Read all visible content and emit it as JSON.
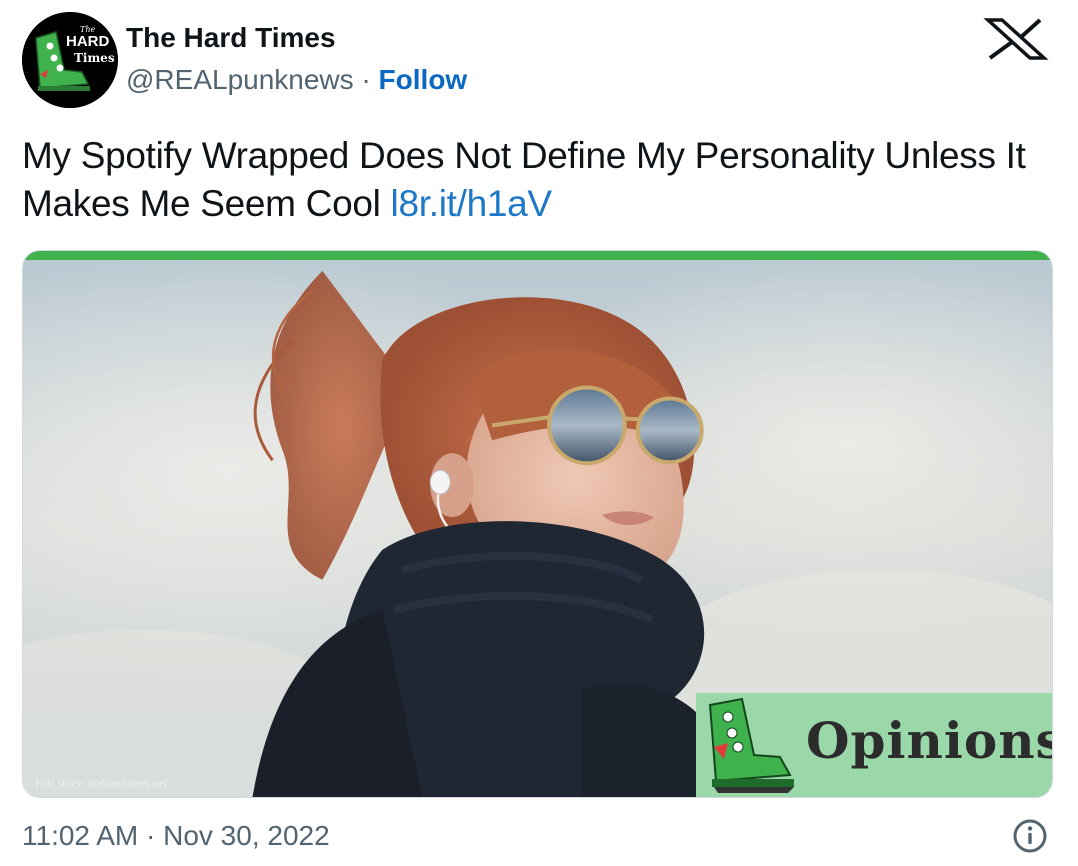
{
  "author": {
    "display_name": "The Hard Times",
    "handle": "@REALpunknews",
    "separator": "·",
    "follow_label": "Follow",
    "avatar": {
      "line1": "The",
      "line2": "HARD",
      "line3": "Times"
    }
  },
  "tweet": {
    "text": "My Spotify Wrapped Does Not Define My Personality Unless It Makes Me Seem Cool",
    "link": "l8r.it/h1aV"
  },
  "media": {
    "credit": "Full story: thehardtimes.net",
    "overlay_label": "Opinions",
    "accent_color": "#3fb14d"
  },
  "footer": {
    "timestamp": "11:02 AM · Nov 30, 2022"
  },
  "icons": {
    "brand": "x-logo-icon",
    "info": "info-icon"
  },
  "colors": {
    "link": "#1d79c8",
    "follow": "#0a67c2",
    "secondary_text": "#536471",
    "opinions_bg": "#9ad7a9"
  }
}
